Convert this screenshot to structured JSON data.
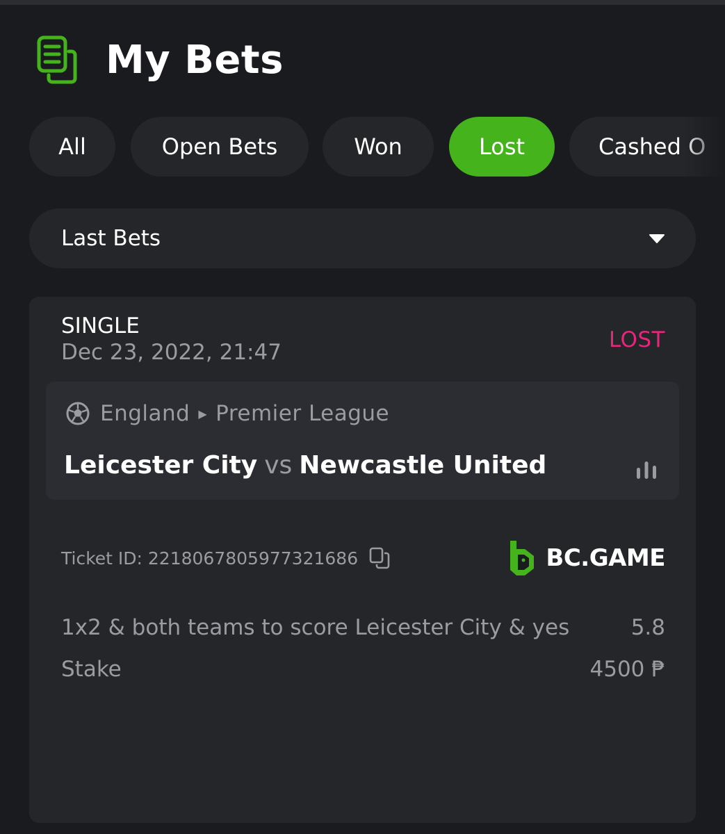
{
  "header": {
    "title": "My Bets",
    "icon": "bets-list-icon",
    "accent": "#45b41c"
  },
  "tabs": [
    {
      "label": "All",
      "active": false
    },
    {
      "label": "Open Bets",
      "active": false
    },
    {
      "label": "Won",
      "active": false
    },
    {
      "label": "Lost",
      "active": true
    },
    {
      "label": "Cashed O",
      "active": false
    }
  ],
  "filter": {
    "selected": "Last Bets"
  },
  "bet": {
    "type": "SINGLE",
    "date": "Dec 23, 2022, 21:47",
    "status": "LOST",
    "status_color": "#e5267a",
    "event": {
      "country": "England",
      "league": "Premier League",
      "home": "Leicester City",
      "vs": "vs",
      "away": "Newcastle United"
    },
    "ticket_label": "Ticket ID: 2218067805977321686",
    "brand": "BC.GAME",
    "selection": "1x2 & both teams to score Leicester City & yes",
    "odds": "5.8",
    "stake_label": "Stake",
    "stake_value": "4500 ₱"
  }
}
